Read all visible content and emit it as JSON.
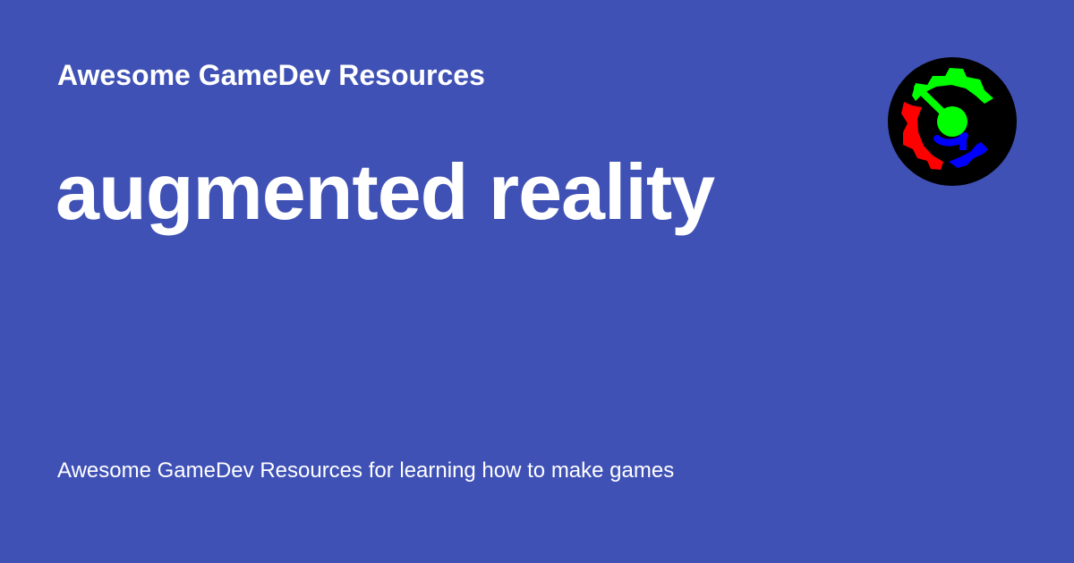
{
  "social_card": {
    "site_title": "Awesome GameDev Resources",
    "page_title": "augmented reality",
    "description": "Awesome GameDev Resources for learning how to make games",
    "background_color": "#3f51b5",
    "text_color": "#ffffff",
    "logo": {
      "icon": "gear-gamedev-logo-icon",
      "colors": {
        "background": "#000000",
        "green": "#00ff00",
        "red": "#ff0000",
        "blue": "#0000ff"
      }
    }
  }
}
